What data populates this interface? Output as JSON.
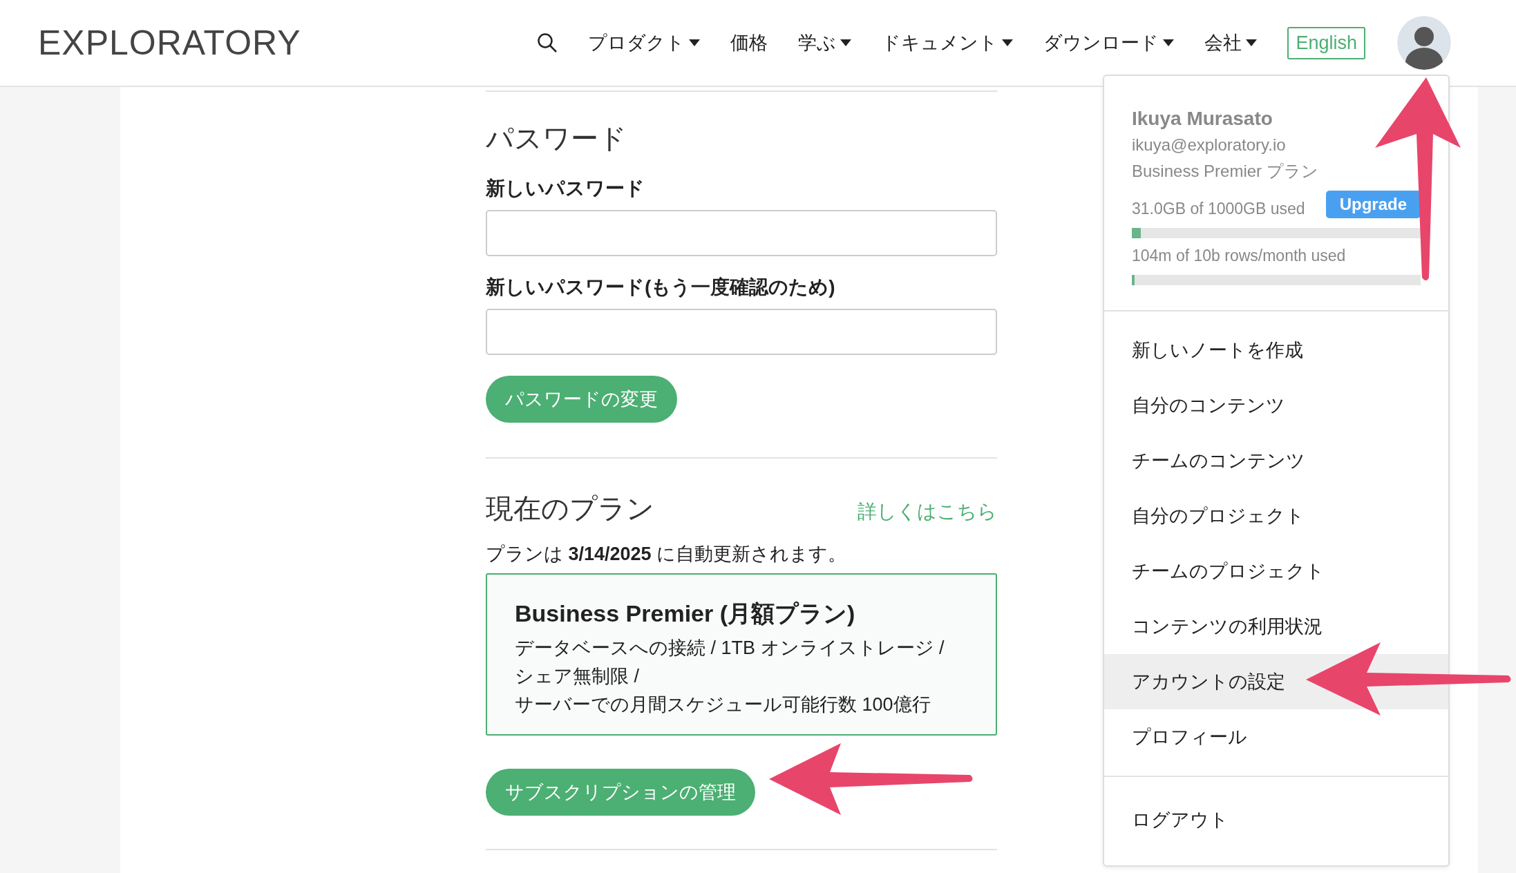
{
  "header": {
    "logo": "EXPLORATORY",
    "nav": [
      {
        "label": "プロダクト",
        "has_menu": true
      },
      {
        "label": "価格",
        "has_menu": false
      },
      {
        "label": "学ぶ",
        "has_menu": true
      },
      {
        "label": "ドキュメント",
        "has_menu": true
      },
      {
        "label": "ダウンロード",
        "has_menu": true
      },
      {
        "label": "会社",
        "has_menu": true
      }
    ],
    "language_button": "English"
  },
  "password": {
    "heading": "パスワード",
    "fields": [
      {
        "label": "新しいパスワード"
      },
      {
        "label": "新しいパスワード(もう一度確認のため)"
      }
    ],
    "button": "パスワードの変更"
  },
  "plan": {
    "heading": "現在のプラン",
    "link": "詳しくはこちら",
    "renewal": "プランは **3/14/2025** に自動更新されます。",
    "title": "Business Premier (月額プラン)",
    "features": [
      "データベースへの接続 /  1TB オンライストレージ /",
      "シェア無制限 /",
      "サーバーでの月間スケジュール可能行数  100億行"
    ],
    "button": "サブスクリプションの管理"
  },
  "user_menu": {
    "name": "Ikuya Murasato",
    "email": "ikuya@exploratory.io",
    "plan": "Business Premier プラン",
    "upgrade_button": "Upgrade",
    "usage": [
      {
        "text": "31.0GB of 1000GB used",
        "level": 0.031
      },
      {
        "text": "104m of 10b rows/month used",
        "level": 0.0104
      }
    ],
    "items": [
      {
        "label": "新しいノートを作成",
        "selected": false
      },
      {
        "label": "自分のコンテンツ",
        "selected": false
      },
      {
        "label": "チームのコンテンツ",
        "selected": false
      },
      {
        "label": "自分のプロジェクト",
        "selected": false
      },
      {
        "label": "チームのプロジェクト",
        "selected": false
      },
      {
        "label": "コンテンツの利用状況",
        "selected": false
      },
      {
        "label": "アカウントの設定",
        "selected": true
      },
      {
        "label": "プロフィール",
        "selected": false
      }
    ],
    "logout": "ログアウト"
  }
}
